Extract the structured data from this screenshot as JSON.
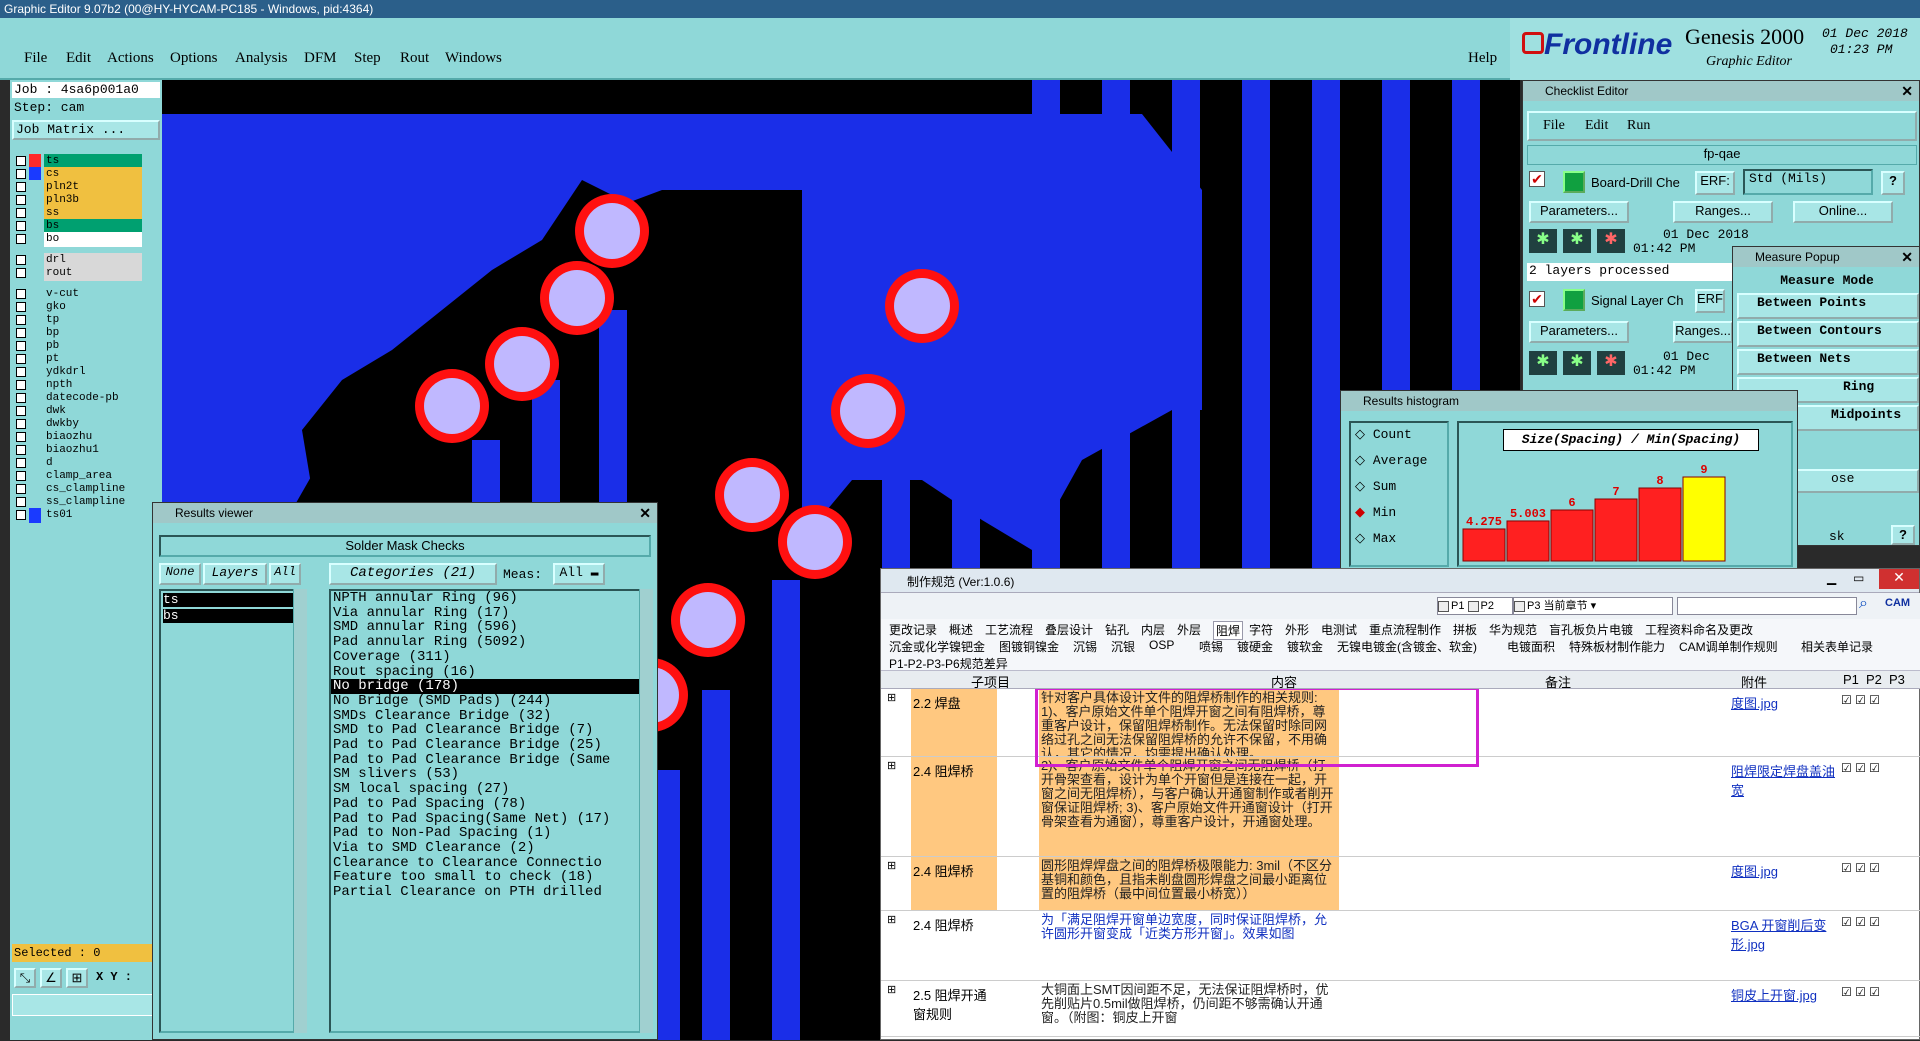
{
  "window_title": "Graphic Editor 9.07b2 (00@HY-HYCAM-PC185 - Windows, pid:4364)",
  "menu": [
    "File",
    "Edit",
    "Actions",
    "Options",
    "Analysis",
    "DFM",
    "Step",
    "Rout",
    "Windows"
  ],
  "help": "Help",
  "brand": {
    "logo": "Frontline",
    "product": "Genesis 2000",
    "subtitle": "Graphic Editor",
    "date": "01 Dec 2018",
    "time": "01:23 PM"
  },
  "job": {
    "job": "Job : 4sa6p001a0",
    "step": "Step: cam",
    "matrix": "Job Matrix ..."
  },
  "layers": [
    {
      "name": "ts",
      "color": "#ff2a2a",
      "bg": "#00a070"
    },
    {
      "name": "cs",
      "color": "#1a3aff",
      "bg": "#f0c040"
    },
    {
      "name": "pln2t",
      "color": "#8fd8d8",
      "bg": "#f0c040"
    },
    {
      "name": "pln3b",
      "color": "#8fd8d8",
      "bg": "#f0c040"
    },
    {
      "name": "ss",
      "color": "#8fd8d8",
      "bg": "#f0c040"
    },
    {
      "name": "bs",
      "color": "#8fd8d8",
      "bg": "#00a070"
    },
    {
      "name": "bo",
      "color": "#8fd8d8",
      "bg": "#ffffff"
    },
    {
      "name": "drl",
      "color": "#8fd8d8",
      "bg": "#d8d8d8"
    },
    {
      "name": "rout",
      "color": "#8fd8d8",
      "bg": "#d8d8d8"
    },
    {
      "name": "v-cut",
      "color": "#8fd8d8",
      "bg": "#8fd8d8"
    },
    {
      "name": "gko",
      "color": "#8fd8d8",
      "bg": "#8fd8d8"
    },
    {
      "name": "tp",
      "color": "#8fd8d8",
      "bg": "#8fd8d8"
    },
    {
      "name": "bp",
      "color": "#8fd8d8",
      "bg": "#8fd8d8"
    },
    {
      "name": "pb",
      "color": "#8fd8d8",
      "bg": "#8fd8d8"
    },
    {
      "name": "pt",
      "color": "#8fd8d8",
      "bg": "#8fd8d8"
    },
    {
      "name": "ydkdrl",
      "color": "#8fd8d8",
      "bg": "#8fd8d8"
    },
    {
      "name": "npth",
      "color": "#8fd8d8",
      "bg": "#8fd8d8"
    },
    {
      "name": "datecode-pb",
      "color": "#8fd8d8",
      "bg": "#8fd8d8"
    },
    {
      "name": "dwk",
      "color": "#8fd8d8",
      "bg": "#8fd8d8"
    },
    {
      "name": "dwkby",
      "color": "#8fd8d8",
      "bg": "#8fd8d8"
    },
    {
      "name": "biaozhu",
      "color": "#8fd8d8",
      "bg": "#8fd8d8"
    },
    {
      "name": "biaozhu1",
      "color": "#8fd8d8",
      "bg": "#8fd8d8"
    },
    {
      "name": "d",
      "color": "#8fd8d8",
      "bg": "#8fd8d8"
    },
    {
      "name": "clamp_area",
      "color": "#8fd8d8",
      "bg": "#8fd8d8"
    },
    {
      "name": "cs_clampline",
      "color": "#8fd8d8",
      "bg": "#8fd8d8"
    },
    {
      "name": "ss_clampline",
      "color": "#8fd8d8",
      "bg": "#8fd8d8"
    },
    {
      "name": "ts01",
      "color": "#1a3aff",
      "bg": "#8fd8d8"
    }
  ],
  "selected": "Selected : 0",
  "xy": "X Y :",
  "results_viewer": {
    "title": "Results viewer",
    "header": "Solder Mask Checks",
    "none": "None",
    "layers": "Layers",
    "all": "All",
    "categories": "Categories (21)",
    "meas": "Meas:",
    "meas_val": "All",
    "layer_list": [
      "ts",
      "bs"
    ],
    "items": [
      "NPTH annular Ring (96)",
      "Via annular Ring (17)",
      "SMD annular Ring (596)",
      "Pad annular Ring (5092)",
      "Coverage (311)",
      "Rout spacing (16)",
      "No bridge (178)",
      "No Bridge (SMD Pads) (244)",
      "SMDs Clearance Bridge (32)",
      "SMD to Pad Clearance Bridge (7)",
      "Pad to Pad Clearance Bridge (25)",
      "Pad to Pad Clearance Bridge (Same",
      "SM slivers (53)",
      "SM local spacing (27)",
      "Pad to Pad Spacing (78)",
      "Pad to Pad Spacing(Same Net) (17)",
      "Pad to Non-Pad Spacing (1)",
      "Via to SMD Clearance (2)",
      "Clearance to Clearance Connectio",
      "Feature too small to check (18)",
      "Partial Clearance on PTH drilled"
    ]
  },
  "checklist": {
    "title": "Checklist Editor",
    "menu": [
      "File",
      "Edit",
      "Run"
    ],
    "name": "fp-qae",
    "check1": "Board-Drill Che",
    "erf": "ERF:",
    "std": "Std (Mils)",
    "params": "Parameters...",
    "ranges": "Ranges...",
    "online": "Online...",
    "date": "01 Dec 2018",
    "time": "01:42 PM",
    "processed": "2 layers processed",
    "check2": "Signal Layer Ch",
    "erf2": "ERF",
    "date2": "01 Dec",
    "time2": "01:42 PM"
  },
  "measure": {
    "title": "Measure Popup",
    "mode": "Measure Mode",
    "items": [
      "Between Points",
      "Between Contours",
      "Between Nets",
      "Ring",
      "Midpoints"
    ],
    "close": "ose",
    "sk": "sk"
  },
  "histogram": {
    "title": "Results histogram",
    "options": [
      "Count",
      "Average",
      "Sum",
      "Min",
      "Max"
    ],
    "label": "Size(Spacing) / Min(Spacing)"
  },
  "chart_data": {
    "type": "bar",
    "title": "Size(Spacing) / Min(Spacing)",
    "categories": [
      "4.275",
      "5.003",
      "6",
      "7",
      "8",
      "9"
    ],
    "values": [
      4.275,
      5.003,
      6,
      7,
      8,
      9
    ],
    "colors": [
      "#ff2020",
      "#ff2020",
      "#ff2020",
      "#ff2020",
      "#ff2020",
      "#ffff00"
    ]
  },
  "spec": {
    "title": "制作规范 (Ver:1.0.6)",
    "p1": "P1",
    "p2": "P2",
    "p3": "P3",
    "chapter": "当前章节",
    "tabs1": [
      "更改记录",
      "概述",
      "工艺流程",
      "叠层设计",
      "钻孔",
      "内层",
      "外层",
      "阻焊",
      "字符",
      "外形",
      "电测试",
      "重点流程制作",
      "拼板",
      "华为规范",
      "盲孔板负片电镀",
      "工程资料命名及更改"
    ],
    "tabs2": [
      "沉金或化学镍钯金",
      "图镀铜镍金",
      "沉锡",
      "沉银",
      "OSP",
      "喷锡",
      "镀硬金",
      "镀软金",
      "无镍电镀金(含镀金、软金)",
      "电镀面积",
      "特殊板材制作能力",
      "CAM调单制作规则",
      "相关表单记录"
    ],
    "tabs3": [
      "P1-P2-P3-P6规范差异"
    ],
    "cols": [
      "子项目",
      "内容",
      "备注",
      "附件",
      "P1",
      "P2",
      "P3"
    ],
    "rows": [
      {
        "item": "2.2 焊盘",
        "content": "针对客户具体设计文件的阻焊桥制作的相关规则:\n1)、客户原始文件单个阻焊开窗之间有阻焊桥，尊重客户设计，保留阻焊桥制作。无法保留时除同网络过孔之间无法保留阻焊桥的允许不保留，不用确认，其它的情况，均需提出确认处理。",
        "att": "度图.jpg"
      },
      {
        "item": "2.4 阻焊桥",
        "content": "2)、客户原始文件单个阻焊开窗之间无阻焊桥（打开骨架查看，设计为单个开窗但是连接在一起，开窗之间无阻焊桥），与客户确认开通窗制作或者削开窗保证阻焊桥;\n3)、客户原始文件开通窗设计（打开骨架查看为通窗），尊重客户设计，开通窗处理。",
        "att": "阻焊限定焊盘盖油宽"
      },
      {
        "item": "2.4 阻焊桥",
        "content": "圆形阻焊焊盘之间的阻焊桥极限能力: 3mil（不区分基铜和颜色，且指未削盘圆形焊盘之间最小距离位置的阻焊桥（最中间位置最小桥宽））",
        "att": "度图.jpg"
      },
      {
        "item": "2.4 阻焊桥",
        "content": "为「满足阻焊开窗单边宽度，同时保证阻焊桥，允许圆形开窗变成「近类方形开窗」。效果如图",
        "att": "BGA 开窗削后变形.jpg"
      },
      {
        "item": "2.5 阻焊开通窗规则",
        "content": "大铜面上SMT因间距不足，无法保证阻焊桥时，优先削贴片0.5mil做阻焊桥，仍间距不够需确认开通窗。（附图：铜皮上开窗",
        "att": "铜皮上开窗.jpg"
      }
    ]
  }
}
